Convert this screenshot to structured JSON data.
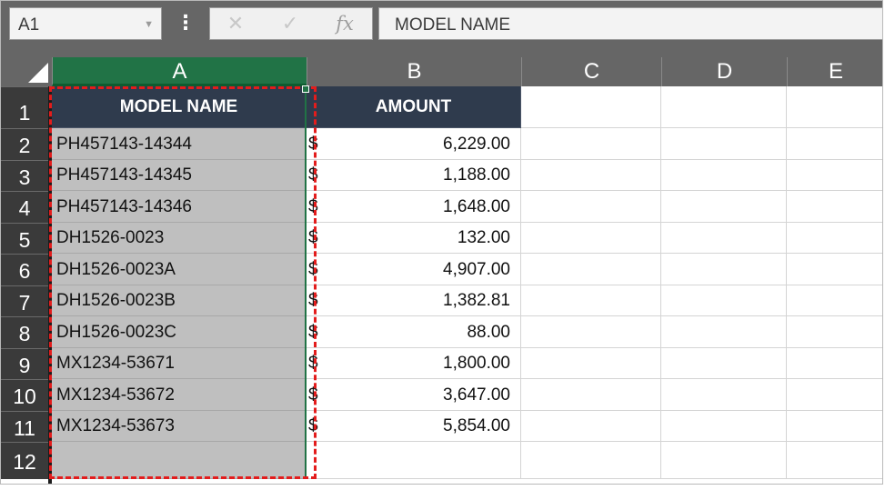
{
  "name_box": {
    "value": "A1"
  },
  "formula_bar": {
    "cancel_glyph": "✕",
    "enter_glyph": "✓",
    "fx_label": "fx",
    "content": "MODEL NAME"
  },
  "columns": [
    "A",
    "B",
    "C",
    "D",
    "E"
  ],
  "rows": [
    "1",
    "2",
    "3",
    "4",
    "5",
    "6",
    "7",
    "8",
    "9",
    "10",
    "11",
    "12"
  ],
  "table": {
    "headers": {
      "model": "MODEL NAME",
      "amount": "AMOUNT"
    },
    "currency_symbol": "$",
    "records": [
      {
        "model": "PH457143-14344",
        "amount": "6,229.00"
      },
      {
        "model": "PH457143-14345",
        "amount": "1,188.00"
      },
      {
        "model": "PH457143-14346",
        "amount": "1,648.00"
      },
      {
        "model": "DH1526-0023",
        "amount": "132.00"
      },
      {
        "model": "DH1526-0023A",
        "amount": "4,907.00"
      },
      {
        "model": "DH1526-0023B",
        "amount": "1,382.81"
      },
      {
        "model": "DH1526-0023C",
        "amount": "88.00"
      },
      {
        "model": "MX1234-53671",
        "amount": "1,800.00"
      },
      {
        "model": "MX1234-53672",
        "amount": "3,647.00"
      },
      {
        "model": "MX1234-53673",
        "amount": "5,854.00"
      }
    ]
  },
  "colors": {
    "selected_column_header": "#217346",
    "table_header_fill": "#2f3b4d",
    "selection_fill": "#bfbfbf",
    "copy_marquee": "#e31c1c"
  }
}
